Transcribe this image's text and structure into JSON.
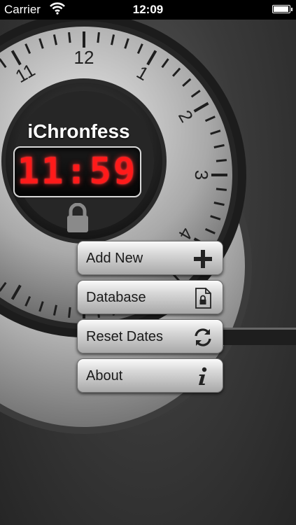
{
  "status_bar": {
    "carrier": "Carrier",
    "time": "12:09",
    "battery_level": 1.0
  },
  "app": {
    "title": "iChronfess",
    "clock": "11:59"
  },
  "dial": {
    "numbers": [
      "12",
      "1",
      "2",
      "3",
      "4",
      "11"
    ]
  },
  "menu": {
    "items": [
      {
        "label": "Add New",
        "icon": "plus-icon"
      },
      {
        "label": "Database",
        "icon": "locked-document-icon"
      },
      {
        "label": "Reset Dates",
        "icon": "refresh-icon"
      },
      {
        "label": "About",
        "icon": "info-icon"
      }
    ]
  },
  "colors": {
    "led": "#ff1a1a",
    "background": "#3a3a3a",
    "button_face": "#d0d0d0"
  }
}
